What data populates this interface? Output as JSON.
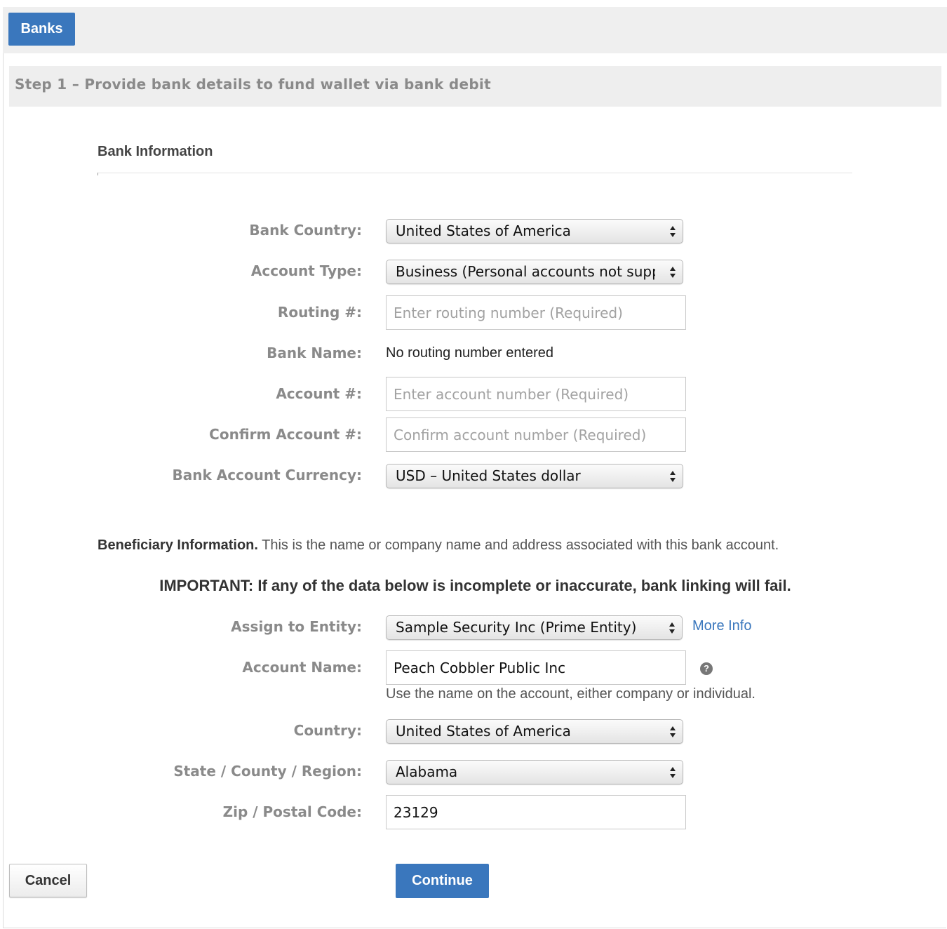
{
  "header": {
    "tab_label": "Banks"
  },
  "step": {
    "title": "Step 1 – Provide bank details to fund wallet via bank debit"
  },
  "bank_info": {
    "section_title": "Bank Information",
    "bank_country": {
      "label": "Bank Country:",
      "value": "United States of America"
    },
    "account_type": {
      "label": "Account Type:",
      "value": "Business (Personal accounts not supp"
    },
    "routing": {
      "label": "Routing #:",
      "placeholder": "Enter routing number (Required)"
    },
    "bank_name": {
      "label": "Bank Name:",
      "value": "No routing number entered"
    },
    "account": {
      "label": "Account #:",
      "placeholder": "Enter account number (Required)"
    },
    "confirm_account": {
      "label": "Confirm Account #:",
      "placeholder": "Confirm account number (Required)"
    },
    "currency": {
      "label": "Bank Account Currency:",
      "value": "USD – United States dollar"
    }
  },
  "beneficiary": {
    "heading": "Beneficiary Information.",
    "description": " This is the name or company name and address associated with this bank account.",
    "important": "IMPORTANT: If any of the data below is incomplete or inaccurate, bank linking will fail.",
    "entity": {
      "label": "Assign to Entity:",
      "value": "Sample Security Inc (Prime Entity)",
      "more_info": "More Info"
    },
    "account_name": {
      "label": "Account Name:",
      "value": "Peach Cobbler Public Inc",
      "hint": "Use the name on the account, either company or individual.",
      "help_glyph": "?"
    },
    "country": {
      "label": "Country:",
      "value": "United States of America"
    },
    "region": {
      "label": "State / County / Region:",
      "value": "Alabama"
    },
    "zip": {
      "label": "Zip / Postal Code:",
      "value": "23129"
    }
  },
  "actions": {
    "cancel": "Cancel",
    "continue": "Continue"
  },
  "colors": {
    "accent": "#3a77bd",
    "label_gray": "#8a8a8a",
    "bar_gray": "#eeeeee"
  }
}
